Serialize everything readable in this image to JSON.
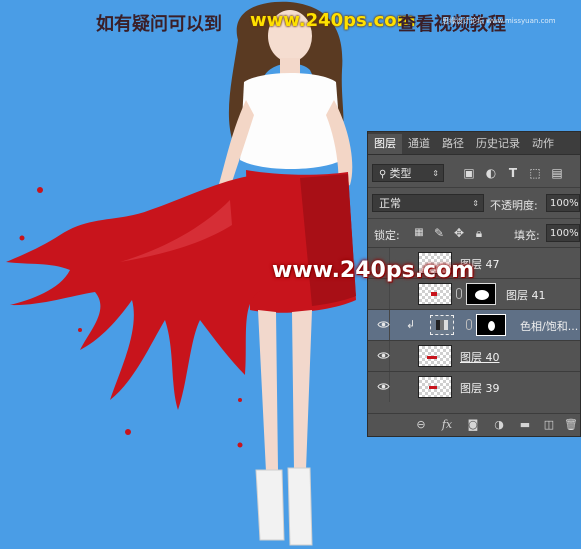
{
  "banner": {
    "text_left": "如有疑问可以到",
    "text_site": "www.240ps.com",
    "text_right": "查看视频教程",
    "credit": "思缘设计论坛 www.missyuan.com"
  },
  "watermark": "www.240ps.com",
  "colors": {
    "background": "#4a9de6",
    "skirt": "#c8141c",
    "panel": "#535353",
    "selected_layer": "#5f7086"
  },
  "layers_panel": {
    "tabs": [
      "图层",
      "通道",
      "路径",
      "历史记录",
      "动作"
    ],
    "active_tab": "图层",
    "filter": {
      "label": "类型",
      "icons": [
        "image-filter-icon",
        "adjustment-filter-icon",
        "type-filter-icon",
        "shape-filter-icon",
        "smart-object-filter-icon"
      ]
    },
    "blend_mode": "正常",
    "opacity_label": "不透明度:",
    "opacity_value": "100%",
    "lock_label": "锁定:",
    "fill_label": "填充:",
    "fill_value": "100%",
    "layers": [
      {
        "name": "图层 47",
        "visible": false,
        "selected": false,
        "mask": false,
        "clipped": false
      },
      {
        "name": "图层 41",
        "visible": false,
        "selected": false,
        "mask": true,
        "clipped": false
      },
      {
        "name": "色相/饱和...",
        "visible": true,
        "selected": true,
        "mask": true,
        "clipped": true,
        "adjustment": true
      },
      {
        "name": "图层 40",
        "visible": true,
        "selected": false,
        "mask": false,
        "clipped": false
      },
      {
        "name": "图层 39",
        "visible": true,
        "selected": false,
        "mask": false,
        "clipped": false
      }
    ],
    "bottom_icons": [
      "link-layers-icon",
      "fx-icon",
      "add-mask-icon",
      "new-adjustment-icon",
      "new-group-icon",
      "new-layer-icon",
      "delete-layer-icon"
    ]
  }
}
